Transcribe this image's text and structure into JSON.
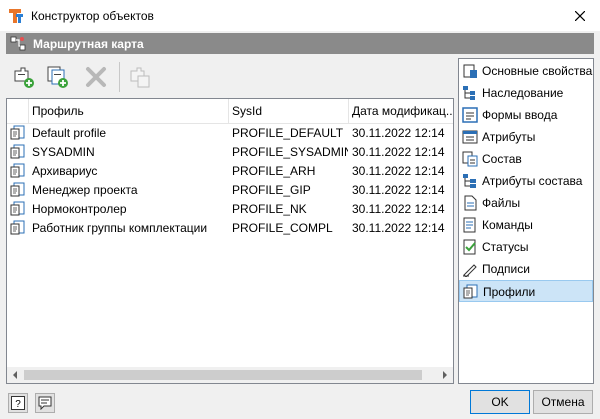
{
  "window": {
    "title": "Конструктор объектов",
    "close_icon": "close-icon"
  },
  "header": {
    "title": "Маршрутная карта",
    "icon": "route-card-icon"
  },
  "toolbar": {
    "buttons": [
      {
        "name": "add-icon",
        "enabled": true
      },
      {
        "name": "add-from-template-icon",
        "enabled": true
      },
      {
        "name": "delete-icon",
        "enabled": false
      },
      {
        "name": "copy-icon",
        "enabled": false
      }
    ]
  },
  "table": {
    "columns": [
      "Профиль",
      "SysId",
      "Дата модификац..."
    ],
    "rows": [
      {
        "profile": "Default profile",
        "sysid": "PROFILE_DEFAULT",
        "date": "30.11.2022 12:14"
      },
      {
        "profile": "SYSADMIN",
        "sysid": "PROFILE_SYSADMIN",
        "date": "30.11.2022 12:14"
      },
      {
        "profile": "Архивариус",
        "sysid": "PROFILE_ARH",
        "date": "30.11.2022 12:14"
      },
      {
        "profile": "Менеджер проекта",
        "sysid": "PROFILE_GIP",
        "date": "30.11.2022 12:14"
      },
      {
        "profile": "Нормоконтролер",
        "sysid": "PROFILE_NK",
        "date": "30.11.2022 12:14"
      },
      {
        "profile": "Работник группы комплектации",
        "sysid": "PROFILE_COMPL",
        "date": "30.11.2022 12:14"
      }
    ]
  },
  "side": {
    "items": [
      {
        "label": "Основные свойства",
        "icon": "properties-icon"
      },
      {
        "label": "Наследование",
        "icon": "inheritance-icon"
      },
      {
        "label": "Формы ввода",
        "icon": "input-forms-icon"
      },
      {
        "label": "Атрибуты",
        "icon": "attributes-icon"
      },
      {
        "label": "Состав",
        "icon": "composition-icon"
      },
      {
        "label": "Атрибуты состава",
        "icon": "composition-attributes-icon"
      },
      {
        "label": "Файлы",
        "icon": "files-icon"
      },
      {
        "label": "Команды",
        "icon": "commands-icon"
      },
      {
        "label": "Статусы",
        "icon": "statuses-icon"
      },
      {
        "label": "Подписи",
        "icon": "signatures-icon"
      },
      {
        "label": "Профили",
        "icon": "profiles-icon"
      }
    ],
    "selected": "Профили"
  },
  "footer": {
    "help_label": "?",
    "ok_label": "OK",
    "cancel_label": "Отмена"
  },
  "colors": {
    "header_bg": "#8a8a8a",
    "selection_bg": "#cce4f7",
    "accent": "#0078d7"
  }
}
